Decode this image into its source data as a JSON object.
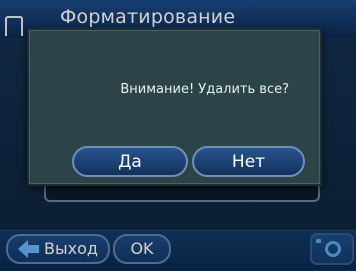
{
  "header": {
    "title": "Форматирование",
    "icon": "document-icon"
  },
  "dialog": {
    "message": "Внимание! Удалить все?",
    "yes_label": "Да",
    "no_label": "Нет"
  },
  "bottom_bar": {
    "back_label": "Выход",
    "back_icon": "arrow-left-icon",
    "ok_label": "OK",
    "camera_icon": "camera-icon"
  },
  "colors": {
    "header_blue": "#14386a",
    "dialog_bg": "#2c4448",
    "accent_blue": "#6bb6ff"
  }
}
